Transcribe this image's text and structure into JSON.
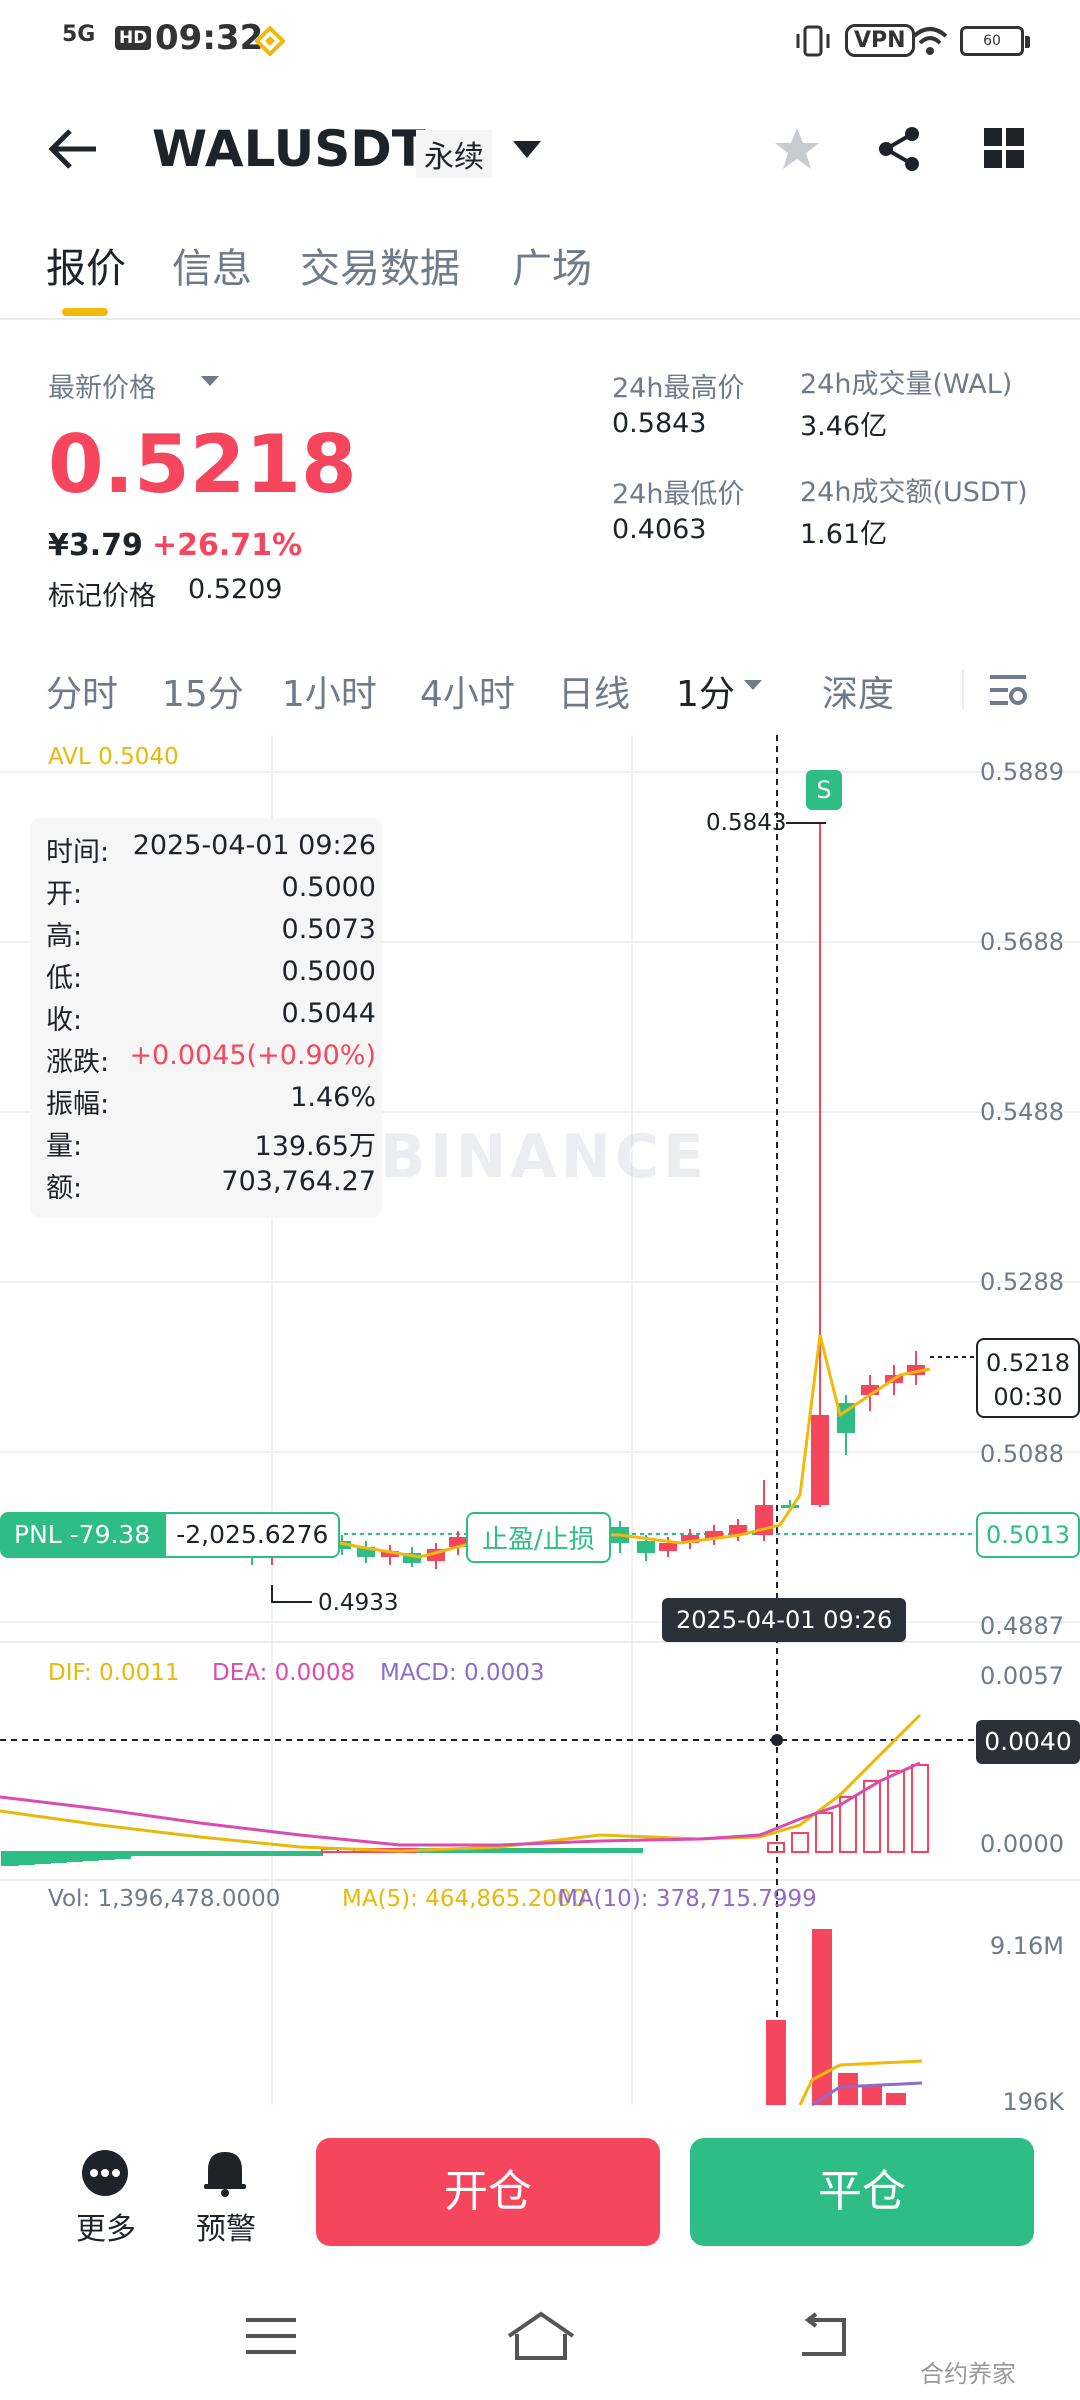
{
  "status_bar": {
    "network": "5G",
    "hd": "HD",
    "time": "09:32",
    "vpn": "VPN",
    "battery": "60"
  },
  "header": {
    "symbol": "WALUSDT",
    "contract_type": "永续"
  },
  "tabs": [
    {
      "label": "报价"
    },
    {
      "label": "信息"
    },
    {
      "label": "交易数据"
    },
    {
      "label": "广场"
    }
  ],
  "price_panel": {
    "latest_label": "最新价格",
    "latest_price": "0.5218",
    "cny_price": "¥3.79",
    "change_pct": "+26.71%",
    "mark_label": "标记价格",
    "mark_price": "0.5209",
    "high_label": "24h最高价",
    "high_value": "0.5843",
    "low_label": "24h最低价",
    "low_value": "0.4063",
    "vol_label": "24h成交量(WAL)",
    "vol_value": "3.46亿",
    "amount_label": "24h成交额(USDT)",
    "amount_value": "1.61亿"
  },
  "periods": [
    {
      "label": "分时"
    },
    {
      "label": "15分"
    },
    {
      "label": "1小时"
    },
    {
      "label": "4小时"
    },
    {
      "label": "日线"
    },
    {
      "label": "1分"
    },
    {
      "label": "深度"
    }
  ],
  "chart": {
    "avl": "AVL 0.5040",
    "price_axis": [
      "0.5889",
      "0.5688",
      "0.5488",
      "0.5288",
      "0.5088",
      "0.4887"
    ],
    "high_marker": "0.5843",
    "low_marker": "0.4933",
    "signal": "S",
    "current_price": "0.5218",
    "countdown": "00:30",
    "position_price": "0.5013",
    "crosshair_time": "2025-04-01 09:26",
    "watermark": "BINANCE",
    "pnl_label": "PNL -79.38",
    "pnl_value": "-2,025.6276",
    "tpsl": "止盈/止损",
    "tooltip": [
      {
        "k": "时间:",
        "v": "2025-04-01 09:26"
      },
      {
        "k": "开:",
        "v": "0.5000"
      },
      {
        "k": "高:",
        "v": "0.5073"
      },
      {
        "k": "低:",
        "v": "0.5000"
      },
      {
        "k": "收:",
        "v": "0.5044"
      },
      {
        "k": "涨跌:",
        "v": "+0.0045(+0.90%)"
      },
      {
        "k": "振幅:",
        "v": "1.46%"
      },
      {
        "k": "量:",
        "v": "139.65万"
      },
      {
        "k": "额:",
        "v": "703,764.27"
      }
    ],
    "macd": {
      "dif": "DIF: 0.0011",
      "dea": "DEA: 0.0008",
      "macd": "MACD: 0.0003",
      "axis_top": "0.0057",
      "axis_zero": "0.0000",
      "crosshair_value": "0.0040"
    },
    "volume": {
      "vol": "Vol: 1,396,478.0000",
      "ma5": "MA(5): 464,865.2000",
      "ma10": "MA(10): 378,715.7999",
      "axis_top": "9.16M",
      "axis_mid": "196K"
    }
  },
  "bottom": {
    "more": "更多",
    "alert": "预警",
    "open": "开仓",
    "close": "平仓"
  },
  "colors": {
    "up": "#f6465d",
    "down": "#2ebd85",
    "accent": "#f0b90b",
    "dif": "#e8b90a",
    "dea": "#d94cb0",
    "macd": "#8e6cc8"
  },
  "corner_watermark": "合约养家"
}
